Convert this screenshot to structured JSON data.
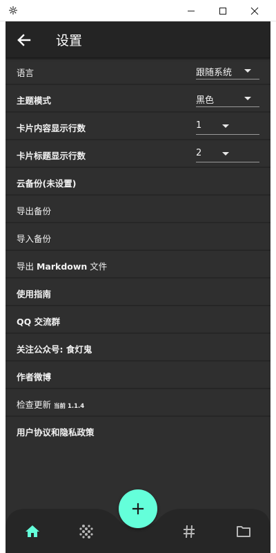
{
  "window": {
    "minimize_glyph": "—",
    "maximize_glyph": "☐",
    "close_glyph": "✕"
  },
  "appbar": {
    "title": "设置",
    "back_icon": "arrow-left-icon"
  },
  "settings": {
    "language": {
      "label": "语言",
      "value": "跟随系统"
    },
    "theme": {
      "label": "主题模式",
      "value": "黑色"
    },
    "card_content_lines": {
      "label": "卡片内容显示行数",
      "value": "1"
    },
    "card_title_lines": {
      "label": "卡片标题显示行数",
      "value": "2"
    },
    "cloud_backup": {
      "label": "云备份(未设置)"
    },
    "export_backup": {
      "label": "导出备份"
    },
    "import_backup": {
      "label": "导入备份"
    },
    "export_markdown": {
      "label_prefix": "导出 ",
      "label_en": "Markdown",
      "label_suffix": " 文件"
    },
    "guide": {
      "label": "使用指南"
    },
    "qq_group": {
      "label": "QQ 交流群"
    },
    "follow_account": {
      "label": "关注公众号: 食灯鬼"
    },
    "author_weibo": {
      "label": "作者微博"
    },
    "check_update": {
      "label": "检查更新",
      "current": "当前 1.1.4"
    },
    "agreement": {
      "label": "用户协议和隐私政策"
    }
  },
  "bottom_nav": {
    "items": [
      "home-icon",
      "explore-icon",
      "tags-icon",
      "folder-icon"
    ],
    "active": "home-icon"
  },
  "fab": {
    "icon": "plus-icon"
  },
  "colors": {
    "accent": "#64ffda",
    "background": "#2f2f2f",
    "appbar": "#242424",
    "nav": "#262626",
    "inactive_icon": "#b8b8b8"
  }
}
